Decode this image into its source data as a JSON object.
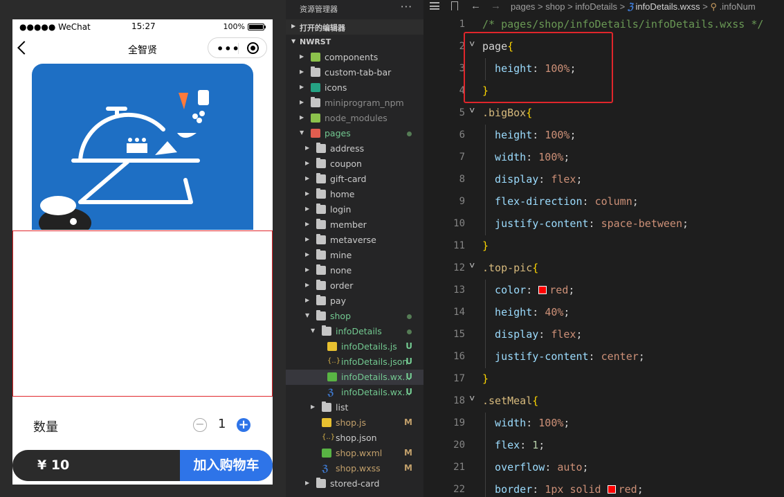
{
  "simulator": {
    "status": {
      "carrier": "●●●●● WeChat",
      "time": "15:27",
      "battery_pct": "100%"
    },
    "nav_title": "全智贤",
    "capsule_more": "•••",
    "qty_label": "数量",
    "qty_value": "1",
    "price": "¥ 10",
    "add_to_cart": "加入购物车",
    "accent": "#2e74e8"
  },
  "explorer": {
    "title": "资源管理器",
    "more": "···",
    "open_editors": "打开的编辑器",
    "project": "NWRST",
    "items": [
      {
        "name": "components",
        "icon": "green-folder",
        "depth": 1,
        "caret": "▸",
        "tone": "text"
      },
      {
        "name": "custom-tab-bar",
        "icon": "folder",
        "depth": 1,
        "caret": "▸",
        "tone": "text"
      },
      {
        "name": "icons",
        "icon": "teal-folder",
        "depth": 1,
        "caret": "▸",
        "tone": "text"
      },
      {
        "name": "miniprogram_npm",
        "icon": "folder",
        "depth": 1,
        "caret": "▸",
        "tone": "grey"
      },
      {
        "name": "node_modules",
        "icon": "green-folder",
        "depth": 1,
        "caret": "▸",
        "tone": "grey"
      },
      {
        "name": "pages",
        "icon": "red-folder",
        "depth": 1,
        "caret": "▾",
        "tone": "green",
        "dot": true
      },
      {
        "name": "address",
        "icon": "folder",
        "depth": 2,
        "caret": "▸",
        "tone": "text"
      },
      {
        "name": "coupon",
        "icon": "folder",
        "depth": 2,
        "caret": "▸",
        "tone": "text"
      },
      {
        "name": "gift-card",
        "icon": "folder",
        "depth": 2,
        "caret": "▸",
        "tone": "text"
      },
      {
        "name": "home",
        "icon": "folder",
        "depth": 2,
        "caret": "▸",
        "tone": "text"
      },
      {
        "name": "login",
        "icon": "folder",
        "depth": 2,
        "caret": "▸",
        "tone": "text"
      },
      {
        "name": "member",
        "icon": "folder",
        "depth": 2,
        "caret": "▸",
        "tone": "text"
      },
      {
        "name": "metaverse",
        "icon": "folder",
        "depth": 2,
        "caret": "▸",
        "tone": "text"
      },
      {
        "name": "mine",
        "icon": "folder",
        "depth": 2,
        "caret": "▸",
        "tone": "text"
      },
      {
        "name": "none",
        "icon": "folder",
        "depth": 2,
        "caret": "▸",
        "tone": "text"
      },
      {
        "name": "order",
        "icon": "folder",
        "depth": 2,
        "caret": "▸",
        "tone": "text"
      },
      {
        "name": "pay",
        "icon": "folder",
        "depth": 2,
        "caret": "▸",
        "tone": "text"
      },
      {
        "name": "shop",
        "icon": "folder",
        "depth": 2,
        "caret": "▾",
        "tone": "green",
        "dot": true
      },
      {
        "name": "infoDetails",
        "icon": "folder",
        "depth": 3,
        "caret": "▾",
        "tone": "green",
        "dot": true
      },
      {
        "name": "infoDetails.js",
        "icon": "js",
        "depth": 4,
        "caret": "",
        "tone": "green",
        "badge": "U"
      },
      {
        "name": "infoDetails.json",
        "icon": "json",
        "depth": 4,
        "caret": "",
        "tone": "green",
        "badge": "U"
      },
      {
        "name": "infoDetails.wx...",
        "icon": "wxml",
        "depth": 4,
        "caret": "",
        "tone": "green",
        "badge": "U",
        "selected": true
      },
      {
        "name": "infoDetails.wx...",
        "icon": "wxss",
        "depth": 4,
        "caret": "",
        "tone": "green",
        "badge": "U"
      },
      {
        "name": "list",
        "icon": "folder",
        "depth": 3,
        "caret": "▸",
        "tone": "text"
      },
      {
        "name": "shop.js",
        "icon": "js",
        "depth": 3,
        "caret": "",
        "tone": "mod",
        "badge": "M"
      },
      {
        "name": "shop.json",
        "icon": "json",
        "depth": 3,
        "caret": "",
        "tone": "text"
      },
      {
        "name": "shop.wxml",
        "icon": "wxml",
        "depth": 3,
        "caret": "",
        "tone": "mod",
        "badge": "M"
      },
      {
        "name": "shop.wxss",
        "icon": "wxss",
        "depth": 3,
        "caret": "",
        "tone": "mod",
        "badge": "M"
      },
      {
        "name": "stored-card",
        "icon": "folder",
        "depth": 2,
        "caret": "▸",
        "tone": "text"
      }
    ]
  },
  "breadcrumb": {
    "segments": [
      "pages",
      "shop",
      "infoDetails"
    ],
    "file": "infoDetails.wxss",
    "symbol": ".infoNum"
  },
  "code_lines": [
    {
      "n": "1",
      "fold": false,
      "guide": false,
      "tokens": [
        [
          "/* pages/shop/infoDetails/infoDetails.wxss */",
          "comment"
        ]
      ]
    },
    {
      "n": "2",
      "fold": true,
      "guide": false,
      "tokens": [
        [
          "page",
          "tag"
        ],
        [
          "{",
          "brace"
        ]
      ]
    },
    {
      "n": "3",
      "fold": false,
      "guide": true,
      "tokens": [
        [
          "  height",
          "prop"
        ],
        [
          ": ",
          "plain"
        ],
        [
          "100%",
          "val"
        ],
        [
          ";",
          "plain"
        ]
      ]
    },
    {
      "n": "4",
      "fold": false,
      "guide": false,
      "tokens": [
        [
          "}",
          "brace"
        ]
      ]
    },
    {
      "n": "5",
      "fold": true,
      "guide": false,
      "tokens": [
        [
          ".bigBox",
          "sel"
        ],
        [
          "{",
          "brace"
        ]
      ]
    },
    {
      "n": "6",
      "fold": false,
      "guide": true,
      "tokens": [
        [
          "  height",
          "prop"
        ],
        [
          ": ",
          "plain"
        ],
        [
          "100%",
          "val"
        ],
        [
          ";",
          "plain"
        ]
      ]
    },
    {
      "n": "7",
      "fold": false,
      "guide": true,
      "tokens": [
        [
          "  width",
          "prop"
        ],
        [
          ": ",
          "plain"
        ],
        [
          "100%",
          "val"
        ],
        [
          ";",
          "plain"
        ]
      ]
    },
    {
      "n": "8",
      "fold": false,
      "guide": true,
      "tokens": [
        [
          "  display",
          "prop"
        ],
        [
          ": ",
          "plain"
        ],
        [
          "flex",
          "val"
        ],
        [
          ";",
          "plain"
        ]
      ]
    },
    {
      "n": "9",
      "fold": false,
      "guide": true,
      "tokens": [
        [
          "  flex-direction",
          "prop"
        ],
        [
          ": ",
          "plain"
        ],
        [
          "column",
          "val"
        ],
        [
          ";",
          "plain"
        ]
      ]
    },
    {
      "n": "10",
      "fold": false,
      "guide": true,
      "tokens": [
        [
          "  justify-content",
          "prop"
        ],
        [
          ": ",
          "plain"
        ],
        [
          "space-between",
          "val"
        ],
        [
          ";",
          "plain"
        ]
      ]
    },
    {
      "n": "11",
      "fold": false,
      "guide": false,
      "tokens": [
        [
          "}",
          "brace"
        ]
      ]
    },
    {
      "n": "12",
      "fold": true,
      "guide": false,
      "tokens": [
        [
          ".top-pic",
          "sel"
        ],
        [
          "{",
          "brace"
        ]
      ]
    },
    {
      "n": "13",
      "fold": false,
      "guide": true,
      "tokens": [
        [
          "  color",
          "prop"
        ],
        [
          ": ",
          "plain"
        ],
        [
          "#swatch",
          "swatch"
        ],
        [
          "red",
          "val"
        ],
        [
          ";",
          "plain"
        ]
      ]
    },
    {
      "n": "14",
      "fold": false,
      "guide": true,
      "tokens": [
        [
          "  height",
          "prop"
        ],
        [
          ": ",
          "plain"
        ],
        [
          "40%",
          "val"
        ],
        [
          ";",
          "plain"
        ]
      ]
    },
    {
      "n": "15",
      "fold": false,
      "guide": true,
      "tokens": [
        [
          "  display",
          "prop"
        ],
        [
          ": ",
          "plain"
        ],
        [
          "flex",
          "val"
        ],
        [
          ";",
          "plain"
        ]
      ]
    },
    {
      "n": "16",
      "fold": false,
      "guide": true,
      "tokens": [
        [
          "  justify-content",
          "prop"
        ],
        [
          ": ",
          "plain"
        ],
        [
          "center",
          "val"
        ],
        [
          ";",
          "plain"
        ]
      ]
    },
    {
      "n": "17",
      "fold": false,
      "guide": false,
      "tokens": [
        [
          "}",
          "brace"
        ]
      ]
    },
    {
      "n": "18",
      "fold": true,
      "guide": false,
      "tokens": [
        [
          ".setMeal",
          "sel"
        ],
        [
          "{",
          "brace"
        ]
      ]
    },
    {
      "n": "19",
      "fold": false,
      "guide": true,
      "tokens": [
        [
          "  width",
          "prop"
        ],
        [
          ": ",
          "plain"
        ],
        [
          "100%",
          "val"
        ],
        [
          ";",
          "plain"
        ]
      ]
    },
    {
      "n": "20",
      "fold": false,
      "guide": true,
      "tokens": [
        [
          "  flex",
          "prop"
        ],
        [
          ": ",
          "plain"
        ],
        [
          "1",
          "num"
        ],
        [
          ";",
          "plain"
        ]
      ]
    },
    {
      "n": "21",
      "fold": false,
      "guide": true,
      "tokens": [
        [
          "  overflow",
          "prop"
        ],
        [
          ": ",
          "plain"
        ],
        [
          "auto",
          "val"
        ],
        [
          ";",
          "plain"
        ]
      ]
    },
    {
      "n": "22",
      "fold": false,
      "guide": true,
      "tokens": [
        [
          "  border",
          "prop"
        ],
        [
          ": ",
          "plain"
        ],
        [
          "1px",
          "val"
        ],
        [
          " ",
          "plain"
        ],
        [
          "solid",
          "val"
        ],
        [
          " ",
          "plain"
        ],
        [
          "#swatch",
          "swatch"
        ],
        [
          "red",
          "val"
        ],
        [
          ";",
          "plain"
        ]
      ]
    }
  ],
  "colors": {
    "editor_bg": "#1e1e1e",
    "explorer_bg": "#252526",
    "highlight_box": "#e0262b",
    "set_meal_border": "#e0262b",
    "add_cart_button": "#2e74e8"
  }
}
